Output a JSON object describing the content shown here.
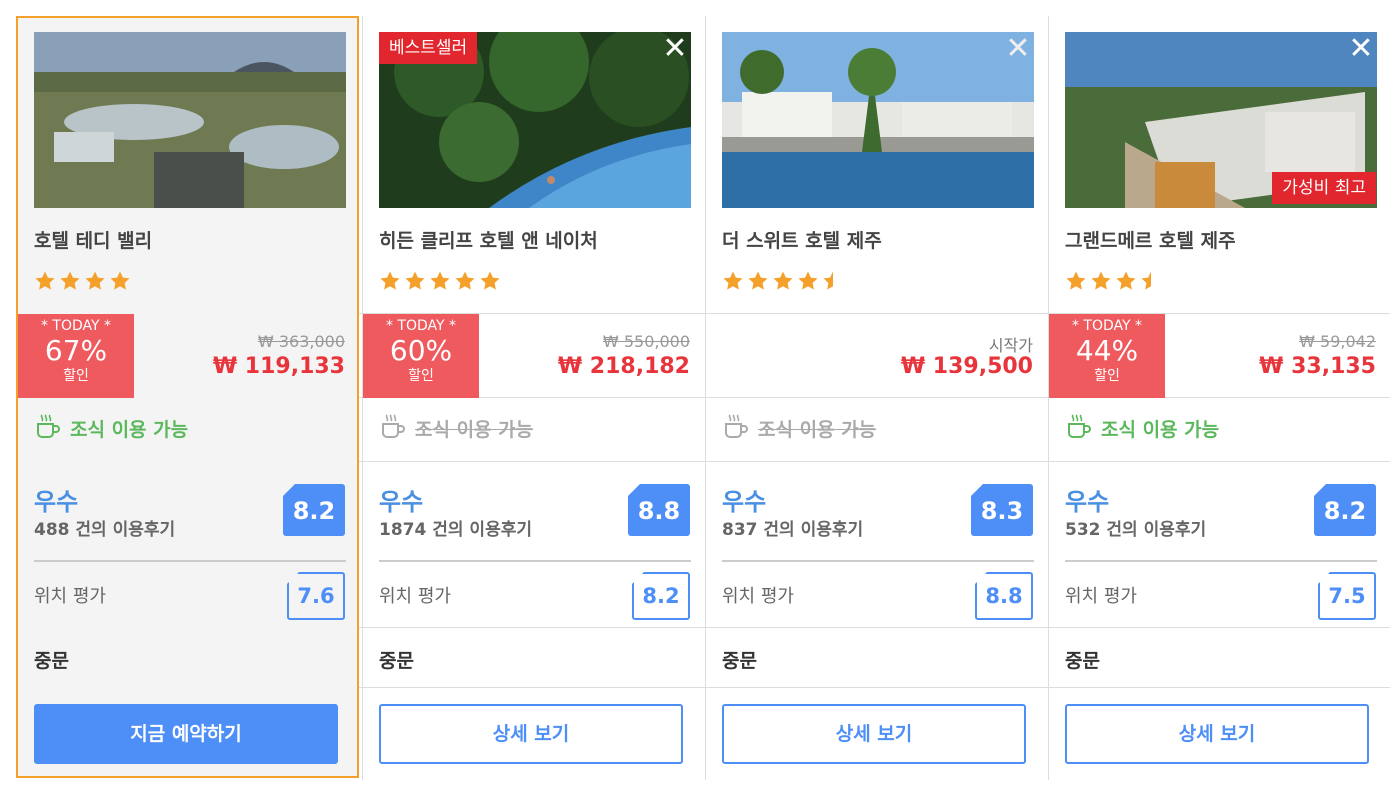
{
  "colors": {
    "accent_blue": "#4e8ef7",
    "price_red": "#e8353b",
    "discount_red": "#ef5a5f",
    "badge_red": "#e2262e",
    "selected_border": "#f5a02a",
    "breakfast_green": "#5cb85c"
  },
  "currency": "₩",
  "today_label": "* TODAY *",
  "discount_suffix": "할인",
  "hotels": [
    {
      "name": "호텔 테디 밸리",
      "star_rating": 4,
      "badge": "",
      "discount_pct": "67%",
      "old_price": "₩ 363,000",
      "price": "₩ 119,133",
      "breakfast": "조식 이용 가능",
      "breakfast_available": true,
      "review_grade": "우수",
      "review_count": "488 건의 이용후기",
      "review_score": "8.2",
      "location_label": "위치 평가",
      "location_score": "7.6",
      "area": "중문",
      "button": "지금 예약하기"
    },
    {
      "name": "히든 클리프 호텔 앤 네이처",
      "star_rating": 5,
      "badge": "베스트셀러",
      "discount_pct": "60%",
      "old_price": "₩ 550,000",
      "price": "₩ 218,182",
      "breakfast": "조식 이용 가능",
      "breakfast_available": false,
      "review_grade": "우수",
      "review_count": "1874 건의 이용후기",
      "review_score": "8.8",
      "location_label": "위치 평가",
      "location_score": "8.2",
      "area": "중문",
      "button": "상세 보기"
    },
    {
      "name": "더 스위트 호텔 제주",
      "star_rating": 4.5,
      "badge": "",
      "start_label": "시작가",
      "price": "₩ 139,500",
      "breakfast": "조식 이용 가능",
      "breakfast_available": false,
      "review_grade": "우수",
      "review_count": "837 건의 이용후기",
      "review_score": "8.3",
      "location_label": "위치 평가",
      "location_score": "8.8",
      "area": "중문",
      "button": "상세 보기"
    },
    {
      "name": "그랜드메르 호텔 제주",
      "star_rating": 3.5,
      "badge": "가성비 최고",
      "discount_pct": "44%",
      "old_price": "₩ 59,042",
      "price": "₩ 33,135",
      "breakfast": "조식 이용 가능",
      "breakfast_available": true,
      "review_grade": "우수",
      "review_count": "532 건의 이용후기",
      "review_score": "8.2",
      "location_label": "위치 평가",
      "location_score": "7.5",
      "area": "중문",
      "button": "상세 보기"
    }
  ]
}
